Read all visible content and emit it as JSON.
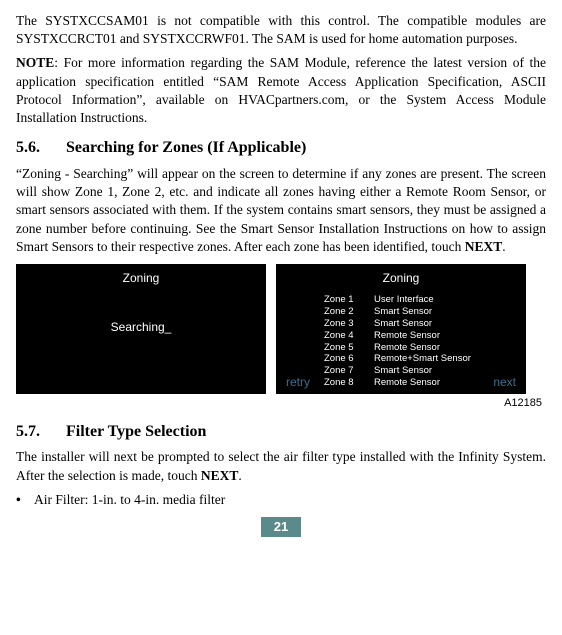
{
  "intro": {
    "p1": "The SYSTXCCSAM01 is not compatible with this control. The compatible modules are SYSTXCCRCT01 and SYSTXCCRWF01. The SAM is used for home automation purposes.",
    "note_label": "NOTE",
    "note_body": ":  For more information regarding the SAM Module, reference the latest version of the application specification entitled “SAM Remote Access Application Specification, ASCII Protocol Information”, available on HVACpartners.com, or the System Access Module Installation Instructions."
  },
  "sec56": {
    "num": "5.6.",
    "title": "Searching for Zones (If Applicable)",
    "body_a": "“Zoning - Searching” will appear on the screen to determine if any zones are present. The screen will show Zone 1, Zone 2, etc. and indicate all zones having either a Remote Room Sensor, or smart sensors associated with them. If the system contains smart sensors, they must be assigned a zone number before continuing. See the Smart Sensor Installation Instructions on how to assign Smart Sensors to their respective zones.  After each zone has been identified, touch ",
    "body_b": "NEXT",
    "body_c": "."
  },
  "screens": {
    "left": {
      "title": "Zoning",
      "center": "Searching_"
    },
    "right": {
      "title": "Zoning",
      "zones": [
        {
          "label": "Zone 1",
          "type": "User Interface"
        },
        {
          "label": "Zone 2",
          "type": "Smart Sensor"
        },
        {
          "label": "Zone 3",
          "type": "Smart Sensor"
        },
        {
          "label": "Zone 4",
          "type": "Remote Sensor"
        },
        {
          "label": "Zone 5",
          "type": "Remote Sensor"
        },
        {
          "label": "Zone 6",
          "type": "Remote+Smart Sensor"
        },
        {
          "label": "Zone 7",
          "type": "Smart Sensor"
        },
        {
          "label": "Zone 8",
          "type": "Remote Sensor"
        }
      ],
      "retry": "retry",
      "next": "next"
    },
    "figid": "A12185"
  },
  "sec57": {
    "num": "5.7.",
    "title": "Filter Type Selection",
    "body_a": "The installer will next be prompted to select the air filter type installed with the Infinity System. After the selection is made, touch ",
    "body_b": "NEXT",
    "body_c": ".",
    "bullet": "Air Filter: 1-in. to 4-in. media filter"
  },
  "page": "21"
}
